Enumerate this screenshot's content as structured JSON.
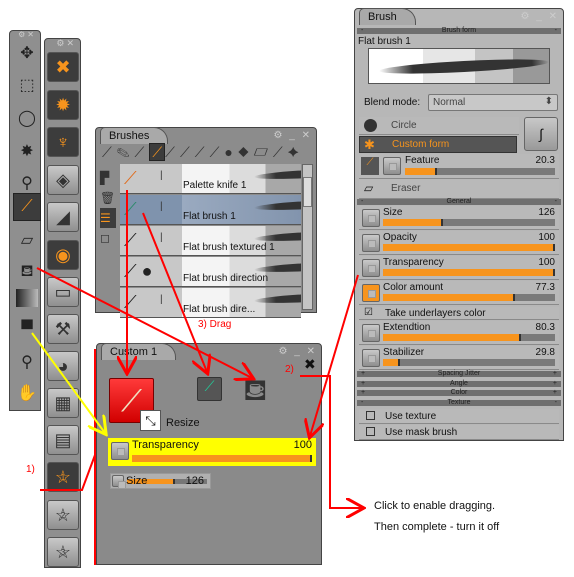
{
  "tools_panel": {
    "items": [
      {
        "icon": "move-icon"
      },
      {
        "icon": "rect-select-icon"
      },
      {
        "icon": "lasso-icon"
      },
      {
        "icon": "magic-wand-icon"
      },
      {
        "icon": "eyedropper-icon"
      },
      {
        "icon": "brush-icon",
        "selected": true
      },
      {
        "icon": "eraser-icon"
      },
      {
        "icon": "fill-bucket-icon"
      },
      {
        "icon": "gradient-icon"
      },
      {
        "icon": "paint-roller-icon"
      },
      {
        "icon": "zoom-icon"
      },
      {
        "icon": "hand-icon"
      }
    ]
  },
  "panels_bar": {
    "items": [
      {
        "icon": "wrench-icon",
        "on": true
      },
      {
        "icon": "brush-settings-icon",
        "on": true
      },
      {
        "icon": "brush-set-icon",
        "on": true
      },
      {
        "icon": "layers-icon"
      },
      {
        "icon": "curves-icon"
      },
      {
        "icon": "color-icon",
        "on": true
      },
      {
        "icon": "image-icon"
      },
      {
        "icon": "hammer-icon"
      },
      {
        "icon": "palette-icon"
      },
      {
        "icon": "swatches-icon"
      },
      {
        "icon": "notes-icon"
      },
      {
        "icon": "custom-panel-1-icon",
        "label": "1",
        "on": true
      },
      {
        "icon": "custom-panel-2-icon",
        "label": "2"
      },
      {
        "icon": "custom-panel-3-icon",
        "label": "3"
      }
    ]
  },
  "brushes": {
    "title": "Brushes",
    "list": [
      {
        "name": "Palette knife 1"
      },
      {
        "name": "Flat brush 1",
        "selected": true
      },
      {
        "name": "Flat brush textured 1"
      },
      {
        "name": "Flat brush direction"
      },
      {
        "name": "Flat brush dire..."
      }
    ]
  },
  "custom": {
    "title": "Custom 1",
    "tooltip": "Resize",
    "transparency": {
      "label": "Transparency",
      "value": "100",
      "level": 1.0
    },
    "size": {
      "label": "Size",
      "value": "126",
      "level": 0.6
    }
  },
  "brush": {
    "title": "Brush",
    "section_form": "Brush form",
    "brush_name": "Flat brush 1",
    "blend_label": "Blend mode:",
    "blend_value": "Normal",
    "circle": "Circle",
    "custom_form": "Custom form",
    "feature": {
      "label": "Feature",
      "value": "20.3",
      "level": 0.21
    },
    "eraser": "Eraser",
    "section_general": "General",
    "sliders": [
      {
        "label": "Size",
        "value": "126",
        "level": 0.35
      },
      {
        "label": "Opacity",
        "value": "100",
        "level": 1.0
      },
      {
        "label": "Transparency",
        "value": "100",
        "level": 1.0
      },
      {
        "label": "Color amount",
        "value": "77.3",
        "level": 0.77
      }
    ],
    "take_underlayers": "Take underlayers color",
    "sliders2": [
      {
        "label": "Extendtion",
        "value": "80.3",
        "level": 0.8
      },
      {
        "label": "Stabilizer",
        "value": "29.8",
        "level": 0.1
      }
    ],
    "sections": [
      "Spacing Jitter",
      "Angle",
      "Color",
      "Texture"
    ],
    "use_texture": "Use texture",
    "use_mask": "Use mask brush"
  },
  "annotations": {
    "step1": "1)",
    "step2": "2)",
    "step3": "3) Drag",
    "note1": "Click to enable dragging.",
    "note2": "Then complete - turn it off"
  },
  "colors": {
    "accent": "#f7941d",
    "highlight": "#ffff00",
    "annotation": "#ff0000",
    "yellow_line": "#ffff00"
  }
}
